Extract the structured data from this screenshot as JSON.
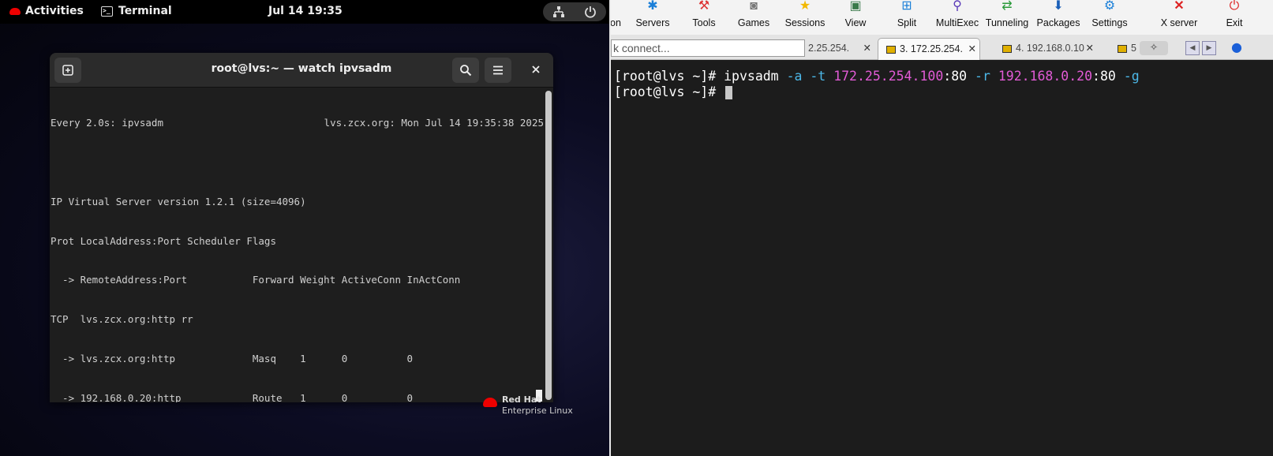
{
  "gnome": {
    "activities": "Activities",
    "app_name": "Terminal",
    "clock": "Jul 14  19:35"
  },
  "terminal": {
    "title": "root@lvs:~ — watch ipvsadm",
    "watch_header": "Every 2.0s: ipvsadm",
    "watch_stamp": "lvs.zcx.org: Mon Jul 14 19:35:38 2025",
    "lines": [
      "",
      "IP Virtual Server version 1.2.1 (size=4096)",
      "Prot LocalAddress:Port Scheduler Flags",
      "  -> RemoteAddress:Port           Forward Weight ActiveConn InActConn",
      "TCP  lvs.zcx.org:http rr",
      "  -> lvs.zcx.org:http             Masq    1      0          0",
      "  -> 192.168.0.20:http            Route   1      0          0"
    ]
  },
  "desktop_logo": {
    "brand": "Red Hat",
    "product": "Enterprise Linux"
  },
  "moba": {
    "toolbar": {
      "session_partial": "on",
      "servers": "Servers",
      "tools": "Tools",
      "games": "Games",
      "sessions": "Sessions",
      "view": "View",
      "split": "Split",
      "multiexec": "MultiExec",
      "tunneling": "Tunneling",
      "packages": "Packages",
      "settings": "Settings",
      "xserver": "X server",
      "exit": "Exit"
    },
    "quick_connect": "k connect...",
    "tabs": {
      "tab2": "2.25.254.",
      "tab3": "3. 172.25.254.",
      "tab4": "4. 192.168.0.10",
      "tab5": "5"
    },
    "terminal": {
      "prompt1": "[root@lvs ~]# ",
      "cmd": "ipvsadm",
      "opt_a": "-a",
      "opt_t": "-t",
      "vip": "172.25.254.100",
      "vip_port": ":80",
      "opt_r": "-r",
      "rip": "192.168.0.20",
      "rip_port": ":80",
      "opt_g": "-g",
      "prompt2": "[root@lvs ~]# "
    }
  },
  "colors": {
    "option_cyan": "#4cb8e8",
    "ip_magenta": "#e25bd6",
    "redhat_red": "#ee0000"
  }
}
